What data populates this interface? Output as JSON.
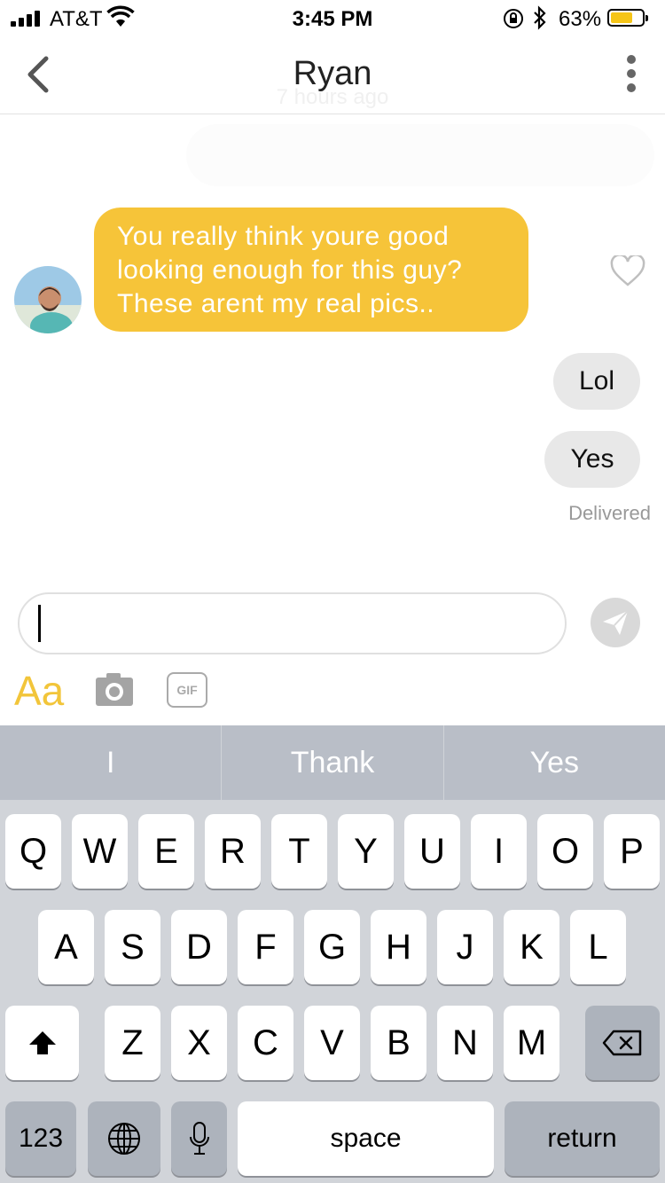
{
  "status_bar": {
    "carrier": "AT&T",
    "time": "3:45 PM",
    "battery_percent": "63%",
    "battery_level": 0.63,
    "icons": [
      "signal-icon",
      "wifi-icon",
      "rotation-lock-icon",
      "bluetooth-icon",
      "battery-icon"
    ]
  },
  "header": {
    "title": "Ryan",
    "subtitle": "7 hours ago"
  },
  "messages": {
    "incoming": [
      {
        "text": "You really think youre good looking enough for this guy? These arent my real pics.."
      }
    ],
    "outgoing": [
      {
        "text": "Lol"
      },
      {
        "text": "Yes"
      }
    ],
    "status": "Delivered"
  },
  "composer": {
    "value": "",
    "font_toggle": "Aa",
    "gif_label": "GIF"
  },
  "keyboard": {
    "suggestions": [
      "I",
      "Thank",
      "Yes"
    ],
    "row1": [
      "Q",
      "W",
      "E",
      "R",
      "T",
      "Y",
      "U",
      "I",
      "O",
      "P"
    ],
    "row2": [
      "A",
      "S",
      "D",
      "F",
      "G",
      "H",
      "J",
      "K",
      "L"
    ],
    "row3": [
      "Z",
      "X",
      "C",
      "V",
      "B",
      "N",
      "M"
    ],
    "numbers_label": "123",
    "space_label": "space",
    "return_label": "return"
  },
  "colors": {
    "accent": "#f6c439",
    "bubble_out": "#e8e8e8",
    "keyboard_bg": "#d1d4d9"
  }
}
